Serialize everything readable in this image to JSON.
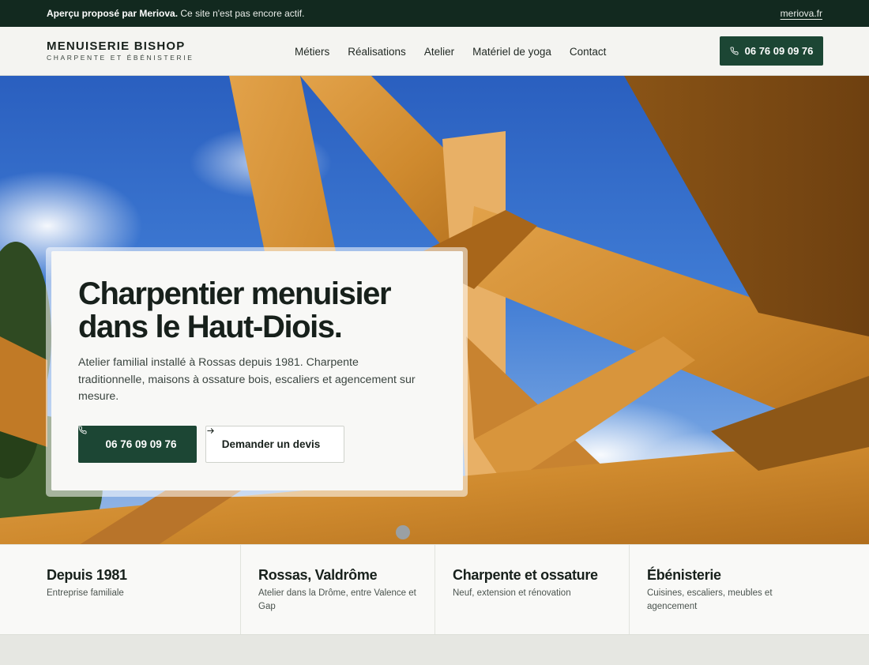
{
  "banner": {
    "lead": "Aperçu proposé par Meriova.",
    "text": "Ce site n'est pas encore actif.",
    "link": "meriova.fr"
  },
  "brand": {
    "name": "MENUISERIE BISHOP",
    "tagline": "CHARPENTE ET ÉBÉNISTERIE"
  },
  "nav": {
    "items": [
      {
        "label": "Métiers"
      },
      {
        "label": "Réalisations"
      },
      {
        "label": "Atelier"
      },
      {
        "label": "Matériel de yoga"
      },
      {
        "label": "Contact"
      }
    ]
  },
  "header": {
    "phone_label": "06 76 09 09 76",
    "phone_icon": "phone-icon"
  },
  "hero": {
    "title": "Charpentier menuisier dans le Haut-Diois.",
    "description": "Atelier familial installé à Rossas depuis 1981. Charpente traditionnelle, maisons à ossature bois, escaliers et agencement sur mesure.",
    "primary_cta": "06 76 09 09 76",
    "secondary_cta": "Demander un devis",
    "secondary_icon": "arrow-right-icon"
  },
  "features": [
    {
      "title": "Depuis 1981",
      "subtitle": "Entreprise familiale"
    },
    {
      "title": "Rossas, Valdrôme",
      "subtitle": "Atelier dans la Drôme, entre Valence et Gap"
    },
    {
      "title": "Charpente et ossature",
      "subtitle": "Neuf, extension et rénovation"
    },
    {
      "title": "Ébénisterie",
      "subtitle": "Cuisines, escaliers, meubles et agencement"
    }
  ],
  "colors": {
    "banner_bg": "#12291f",
    "accent": "#1c4634",
    "page_bg": "#e6e7e2"
  }
}
